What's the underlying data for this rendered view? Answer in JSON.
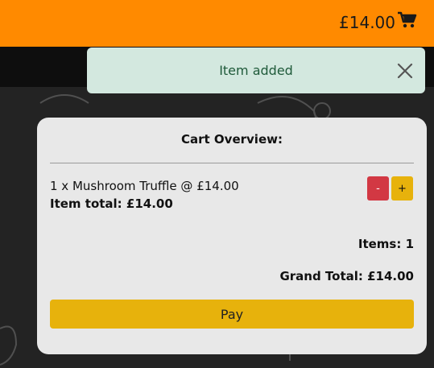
{
  "header": {
    "cart_total": "£14.00",
    "cart_icon": "shopping-cart-icon"
  },
  "toast": {
    "message": "Item added",
    "close_icon": "close-icon"
  },
  "cart": {
    "title": "Cart Overview:",
    "items": [
      {
        "description": "1 x Mushroom Truffle @ £14.00",
        "item_total": "Item total: £14.00",
        "minus_label": "-",
        "plus_label": "+"
      }
    ],
    "items_count": "Items: 1",
    "grand_total": "Grand Total: £14.00",
    "pay_label": "Pay"
  },
  "colors": {
    "header": "#ff8a00",
    "toast_bg": "#d3e8df",
    "minus": "#d23843",
    "accent": "#e7b20c",
    "card": "#e8e8e8"
  }
}
